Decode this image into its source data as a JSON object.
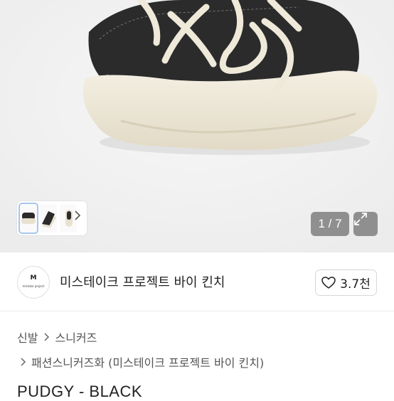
{
  "gallery": {
    "counter": "1 / 7",
    "thumbnails": [
      "thumbnail-1",
      "thumbnail-2",
      "thumbnail-3"
    ]
  },
  "brand": {
    "logo_mark": "M",
    "logo_sub": "mistake project",
    "name": "미스테이크 프로젝트 바이 킨치"
  },
  "like": {
    "count": "3.7천"
  },
  "breadcrumb": {
    "items": [
      "신발",
      "스니커즈"
    ],
    "sub": "패션스니커즈화 (미스테이크 프로젝트 바이 킨치)"
  },
  "product": {
    "title": "PUDGY - BLACK"
  },
  "colors": {
    "shoe_upper": "#2b2b2b",
    "sole": "#ece6d6",
    "lace": "#efe9da",
    "badge": "#8f8f8f"
  }
}
